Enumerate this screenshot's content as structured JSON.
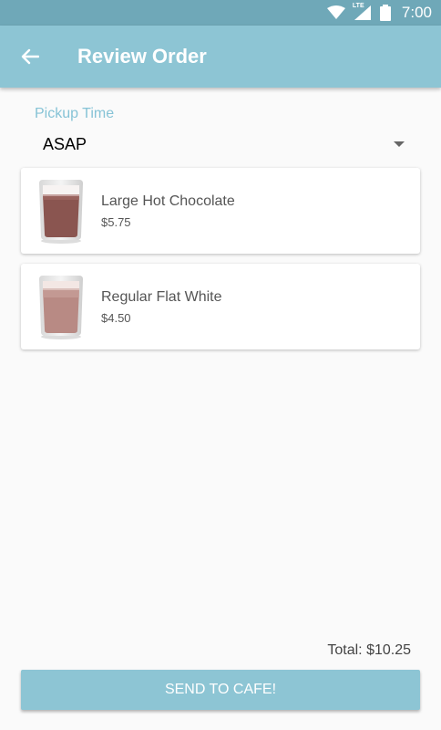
{
  "status_bar": {
    "time": "7:00",
    "network": "LTE"
  },
  "app_bar": {
    "title": "Review Order",
    "back_icon": "arrow-left-icon"
  },
  "pickup": {
    "label": "Pickup Time",
    "value": "ASAP"
  },
  "order_items": [
    {
      "name": "Large Hot Chocolate",
      "price": "$5.75",
      "icon": "hot-chocolate-cup-icon"
    },
    {
      "name": "Regular Flat White",
      "price": "$4.50",
      "icon": "flat-white-cup-icon"
    }
  ],
  "total": "Total: $10.25",
  "send_button": "SEND TO CAFE!",
  "colors": {
    "primary": "#8dc5d4",
    "primary_dark": "#6fa8b8",
    "accent_text": "#86c3d6"
  }
}
